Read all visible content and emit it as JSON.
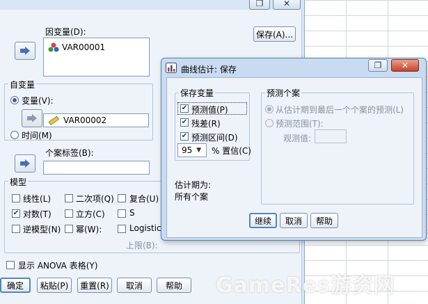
{
  "main_dialog": {
    "dependent_label": "因变量(D):",
    "dependent_items": [
      "VAR00001"
    ],
    "save_button": "保存(A)...",
    "independent_group": "自变量",
    "variable_radio": "变量(V):",
    "variable_value": "VAR00002",
    "time_radio": "时间(M)",
    "case_label": "个案标签(B):",
    "model_group": "模型",
    "models": [
      {
        "label": "线性(L)",
        "checked": false
      },
      {
        "label": "二次项(Q)",
        "checked": false
      },
      {
        "label": "复合(U)",
        "checked": false
      },
      {
        "label": "对数(T)",
        "checked": true
      },
      {
        "label": "立方(C)",
        "checked": false
      },
      {
        "label": "S",
        "checked": false
      },
      {
        "label": "逆模型(N)",
        "checked": false
      },
      {
        "label": "幂(W):",
        "checked": false
      },
      {
        "label": "Logistic",
        "checked": false
      }
    ],
    "upper_limit_label": "上限(B):",
    "anova_label": "显示 ANOVA 表格(Y)",
    "buttons": [
      "确定",
      "粘贴(P)",
      "重置(R)",
      "取消",
      "帮助"
    ]
  },
  "save_dialog": {
    "title": "曲线估计: 保存",
    "save_vars_group": "保存变量",
    "save_vars": [
      {
        "label": "预测值(P)",
        "checked": true
      },
      {
        "label": "残差(R)",
        "checked": true
      },
      {
        "label": "预测区间(D)",
        "checked": true
      }
    ],
    "confidence_value": "95",
    "confidence_label": "% 置信(C)",
    "predict_group": "预测个案",
    "predict_from_estimation": "从估计期到最后一个个案的预测(L)",
    "predict_through": "预测范围(T):",
    "observation_label": "观测值:",
    "estimation_period_label": "估计期为:",
    "estimation_period_value": "所有个案",
    "buttons": [
      "继续",
      "取消",
      "帮助"
    ]
  },
  "watermark": "GameRes游资网"
}
